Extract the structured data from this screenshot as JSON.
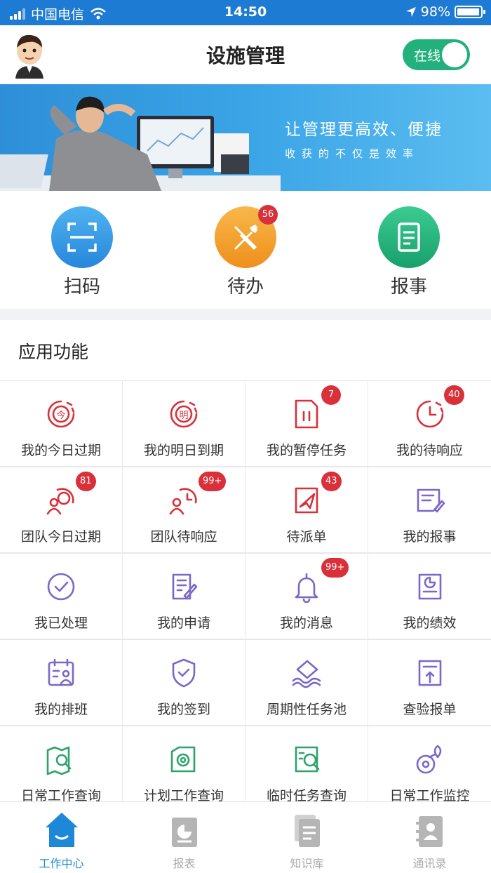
{
  "status_bar": {
    "carrier": "中国电信",
    "time": "14:50",
    "battery": "98%",
    "battery_level": 0.98
  },
  "header": {
    "title": "设施管理",
    "online_label": "在线",
    "online": true
  },
  "banner": {
    "headline": "让管理更高效、便捷",
    "subline": "收获的不仅是效率"
  },
  "quick_actions": [
    {
      "label": "扫码",
      "icon": "scan-icon",
      "color": "#2E9BE6"
    },
    {
      "label": "待办",
      "icon": "tools-icon",
      "color": "#F3A12C",
      "badge": "56"
    },
    {
      "label": "报事",
      "icon": "clipboard-icon",
      "color": "#24B07C"
    }
  ],
  "section": {
    "title": "应用功能"
  },
  "grid": [
    {
      "label": "我的今日过期",
      "icon": "today-expired-icon",
      "badge": ""
    },
    {
      "label": "我的明日到期",
      "icon": "tomorrow-due-icon",
      "badge": ""
    },
    {
      "label": "我的暂停任务",
      "icon": "paused-task-icon",
      "badge": "7"
    },
    {
      "label": "我的待响应",
      "icon": "pending-response-icon",
      "badge": "40"
    },
    {
      "label": "团队今日过期",
      "icon": "team-today-expired-icon",
      "badge": "81"
    },
    {
      "label": "团队待响应",
      "icon": "team-pending-icon",
      "badge": "99+"
    },
    {
      "label": "待派单",
      "icon": "dispatch-icon",
      "badge": "43"
    },
    {
      "label": "我的报事",
      "icon": "my-report-icon",
      "badge": ""
    },
    {
      "label": "我已处理",
      "icon": "check-circle-icon",
      "badge": ""
    },
    {
      "label": "我的申请",
      "icon": "application-icon",
      "badge": ""
    },
    {
      "label": "我的消息",
      "icon": "bell-icon",
      "badge": "99+"
    },
    {
      "label": "我的绩效",
      "icon": "performance-icon",
      "badge": ""
    },
    {
      "label": "我的排班",
      "icon": "schedule-icon",
      "badge": ""
    },
    {
      "label": "我的签到",
      "icon": "checkin-icon",
      "badge": ""
    },
    {
      "label": "周期性任务池",
      "icon": "task-pool-icon",
      "badge": ""
    },
    {
      "label": "查验报单",
      "icon": "inspect-report-icon",
      "badge": ""
    },
    {
      "label": "日常工作查询",
      "icon": "daily-query-icon",
      "badge": ""
    },
    {
      "label": "计划工作查询",
      "icon": "plan-query-icon",
      "badge": ""
    },
    {
      "label": "临时任务查询",
      "icon": "temp-query-icon",
      "badge": ""
    },
    {
      "label": "日常工作监控",
      "icon": "monitor-icon",
      "badge": ""
    }
  ],
  "tabbar": [
    {
      "label": "工作中心",
      "icon": "home-icon",
      "active": true
    },
    {
      "label": "报表",
      "icon": "report-icon",
      "active": false
    },
    {
      "label": "知识库",
      "icon": "knowledge-icon",
      "active": false
    },
    {
      "label": "通讯录",
      "icon": "contacts-icon",
      "active": false
    }
  ],
  "colors": {
    "red": "#D9303A",
    "purple": "#7C67C9",
    "green": "#2DA36B",
    "blue": "#1E88D8",
    "status": "#1E7BD3"
  }
}
